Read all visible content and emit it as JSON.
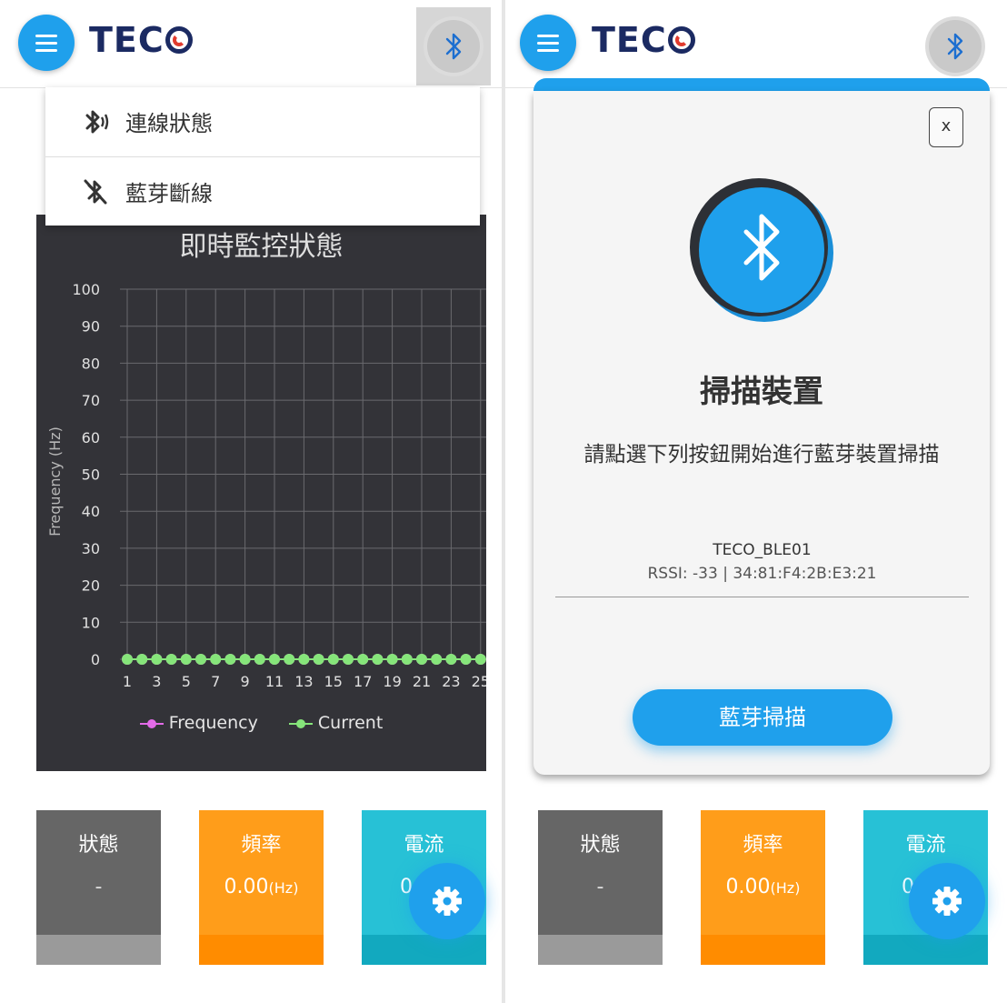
{
  "app": {
    "logo_text": "TEC",
    "logo_icon": "teco-o-mark"
  },
  "colors": {
    "accent": "#1fa0ec",
    "chart_bg": "#333338",
    "frequency_series": "#e36be8",
    "current_series": "#86e57a",
    "status_card": "#666666",
    "frequency_card": "#ff9d1a",
    "current_card": "#27c1d6"
  },
  "left": {
    "dropdown": {
      "items": [
        {
          "label": "連線狀態",
          "icon": "bluetooth-connected-icon"
        },
        {
          "label": "藍芽斷線",
          "icon": "bluetooth-disabled-icon"
        }
      ]
    },
    "chart_title": "即時監控狀態"
  },
  "chart_data": {
    "type": "line",
    "title": "即時監控狀態",
    "ylabel": "Frequency (Hz)",
    "xlabel": "",
    "ylim": [
      0,
      100
    ],
    "yticks": [
      0,
      10,
      20,
      30,
      40,
      50,
      60,
      70,
      80,
      90,
      100
    ],
    "x": [
      1,
      2,
      3,
      4,
      5,
      6,
      7,
      8,
      9,
      10,
      11,
      12,
      13,
      14,
      15,
      16,
      17,
      18,
      19,
      20,
      21,
      22,
      23,
      24,
      25
    ],
    "xtick_labels": [
      "1",
      "3",
      "5",
      "7",
      "9",
      "11",
      "13",
      "15",
      "17",
      "19",
      "21",
      "23",
      "25"
    ],
    "series": [
      {
        "name": "Frequency",
        "values": [
          0,
          0,
          0,
          0,
          0,
          0,
          0,
          0,
          0,
          0,
          0,
          0,
          0,
          0,
          0,
          0,
          0,
          0,
          0,
          0,
          0,
          0,
          0,
          0,
          0
        ]
      },
      {
        "name": "Current",
        "values": [
          0,
          0,
          0,
          0,
          0,
          0,
          0,
          0,
          0,
          0,
          0,
          0,
          0,
          0,
          0,
          0,
          0,
          0,
          0,
          0,
          0,
          0,
          0,
          0,
          0
        ]
      }
    ],
    "legend": "bottom",
    "grid": true
  },
  "cards": {
    "status": {
      "label": "狀態",
      "value": "-"
    },
    "frequency": {
      "label": "頻率",
      "value": "0.00",
      "unit": "(Hz)"
    },
    "current": {
      "label": "電流",
      "value": "0"
    }
  },
  "modal": {
    "close_label": "x",
    "title": "掃描裝置",
    "description": "請點選下列按鈕開始進行藍芽裝置掃描",
    "device": {
      "name": "TECO_BLE01",
      "info": "RSSI: -33 | 34:81:F4:2B:E3:21"
    },
    "scan_button": "藍芽掃描"
  }
}
